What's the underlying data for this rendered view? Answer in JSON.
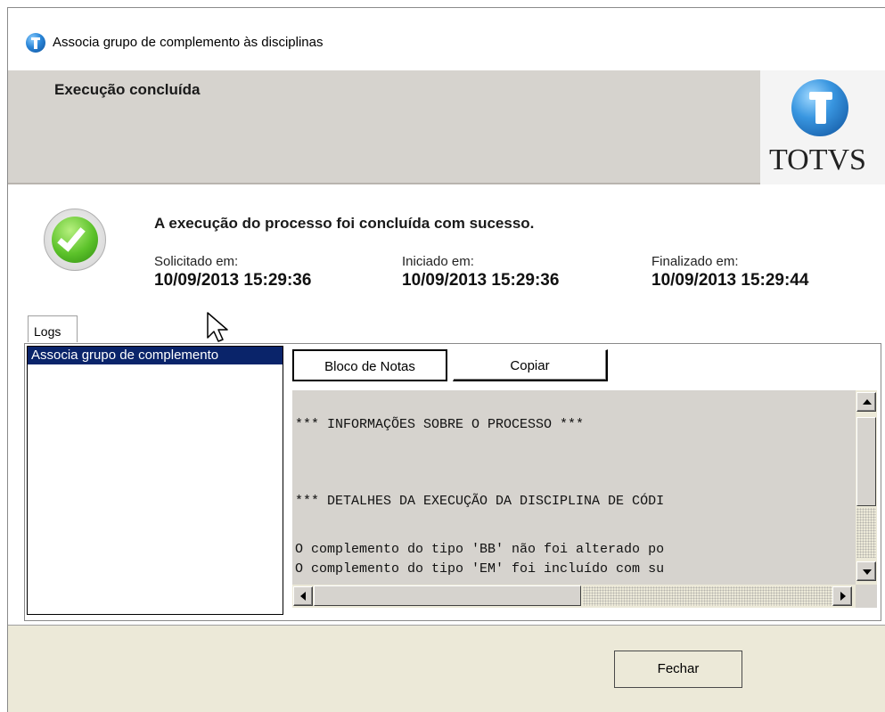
{
  "window": {
    "title": "Associa grupo de complemento às disciplinas"
  },
  "header": {
    "title": "Execução concluída",
    "logo_text": "TOTVS"
  },
  "status": {
    "message": "A execução do processo foi concluída com sucesso.",
    "requested_label": "Solicitado em:",
    "requested_value": "10/09/2013 15:29:36",
    "started_label": "Iniciado em:",
    "started_value": "10/09/2013 15:29:36",
    "finished_label": "Finalizado em:",
    "finished_value": "10/09/2013 15:29:44"
  },
  "tabs": {
    "logs": "Logs"
  },
  "log_list": {
    "items": [
      "Associa grupo de complemento"
    ]
  },
  "log_toolbar": {
    "notepad": "Bloco de Notas",
    "copy": "Copiar"
  },
  "log_lines": [
    "*** INFORMAÇÕES SOBRE O PROCESSO ***",
    "*** DETALHES DA EXECUÇÃO DA DISCIPLINA DE CÓDI",
    "O complemento do tipo 'BB' não foi alterado po",
    "O complemento do tipo 'EM' foi incluído com su"
  ],
  "footer": {
    "close": "Fechar"
  },
  "colors": {
    "header_band": "#d6d3ce",
    "selection": "#0a246a",
    "footer": "#ece9d8"
  }
}
